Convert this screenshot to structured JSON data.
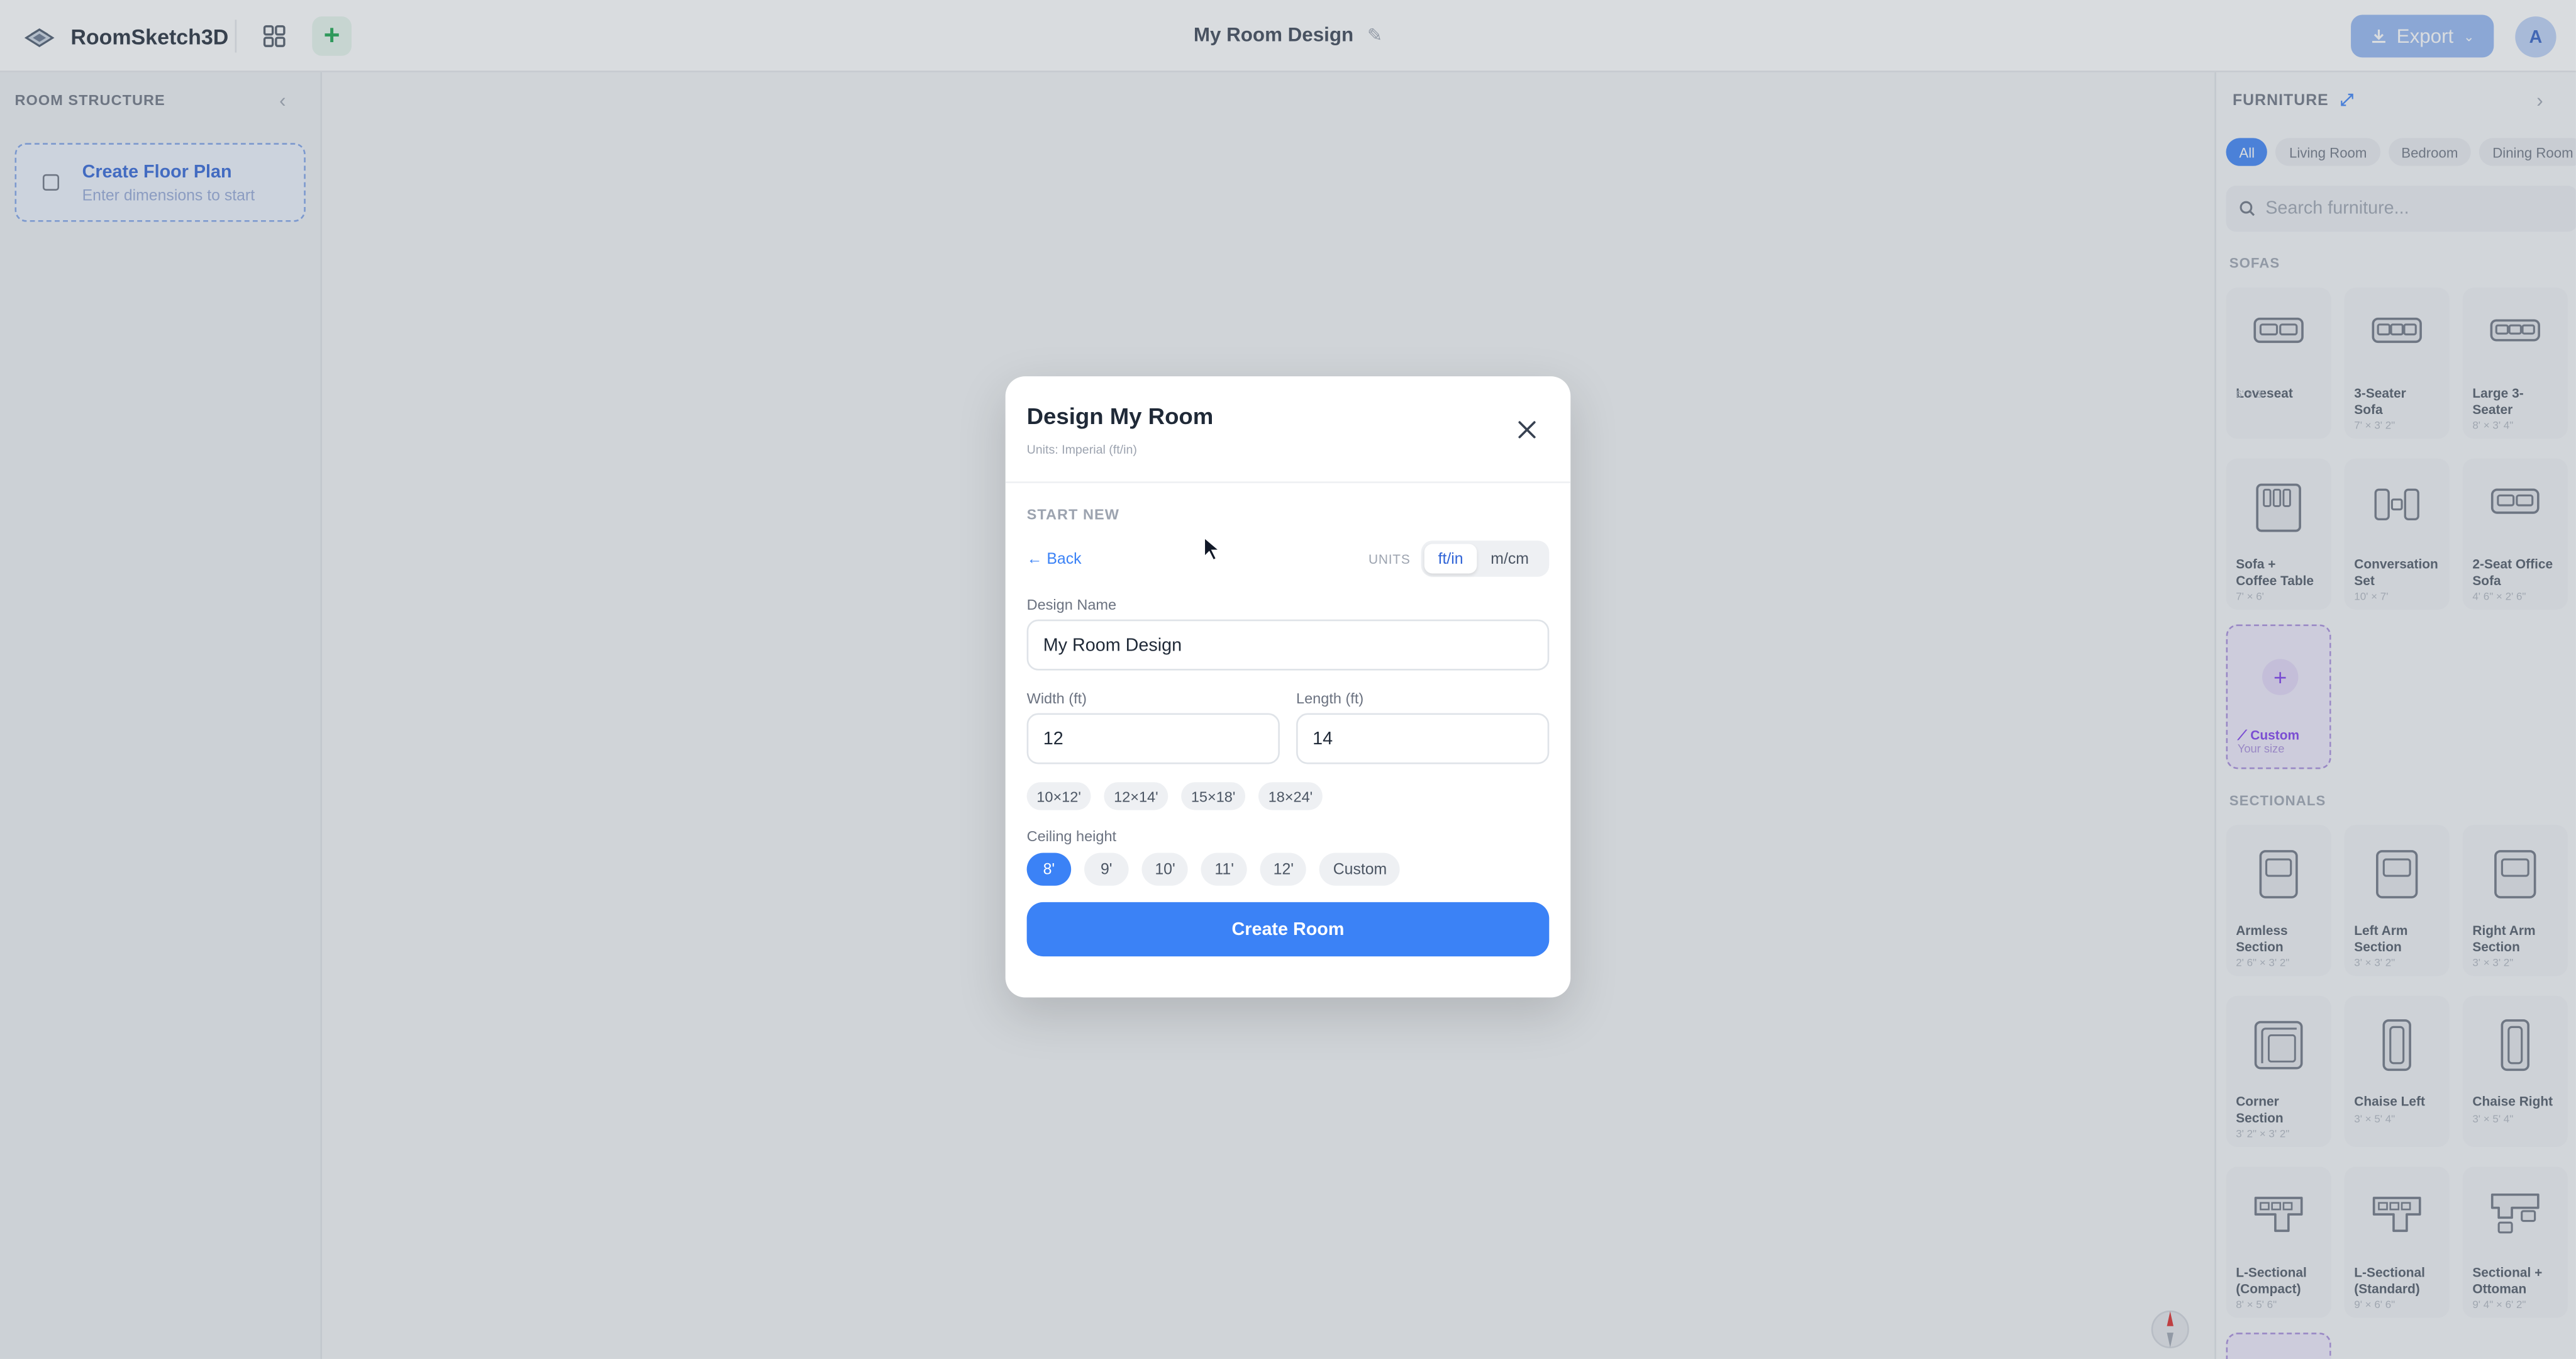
{
  "header": {
    "app_name": "RoomSketch3D",
    "design_title": "My Room Design",
    "export_label": "Export",
    "avatar_initial": "A"
  },
  "left_panel": {
    "title": "ROOM STRUCTURE",
    "floor_plan": {
      "title": "Create Floor Plan",
      "subtitle": "Enter dimensions to start"
    }
  },
  "right_panel": {
    "title": "FURNITURE",
    "tabs": [
      "All",
      "Living Room",
      "Bedroom",
      "Dining Room"
    ],
    "search_placeholder": "Search furniture...",
    "sections": {
      "sofas": "SOFAS",
      "sectionals": "SECTIONALS"
    },
    "sofas": [
      {
        "name": "Loveseat",
        "name2": "",
        "dim": "6' × 3'"
      },
      {
        "name": "3-Seater",
        "name2": "Sofa",
        "dim": "7' × 3' 2\""
      },
      {
        "name": "Large 3-",
        "name2": "Seater",
        "dim": "8' × 3' 4\""
      },
      {
        "name": "Sofa +",
        "name2": "Coffee Table",
        "dim": "7' × 6'"
      },
      {
        "name": "Conversation",
        "name2": "Set",
        "dim": "10' × 7'"
      },
      {
        "name": "2-Seat Office",
        "name2": "Sofa",
        "dim": "4' 6\" × 2' 6\""
      }
    ],
    "custom": {
      "label": "Custom",
      "sub": "Your size"
    },
    "sectionals": [
      {
        "name": "Armless",
        "name2": "Section",
        "dim": "2' 6\" × 3' 2\""
      },
      {
        "name": "Left Arm",
        "name2": "Section",
        "dim": "3' × 3' 2\""
      },
      {
        "name": "Right Arm",
        "name2": "Section",
        "dim": "3' × 3' 2\""
      },
      {
        "name": "Corner",
        "name2": "Section",
        "dim": "3' 2\" × 3' 2\""
      },
      {
        "name": "Chaise Left",
        "name2": "",
        "dim": "3' × 5' 4\""
      },
      {
        "name": "Chaise Right",
        "name2": "",
        "dim": "3' × 5' 4\""
      },
      {
        "name": "L-Sectional",
        "name2": "(Compact)",
        "dim": "8' × 5' 6\""
      },
      {
        "name": "L-Sectional",
        "name2": "(Standard)",
        "dim": "9' × 6' 6\""
      },
      {
        "name": "Sectional +",
        "name2": "Ottoman",
        "dim": "9' 4\" × 6' 2\""
      }
    ]
  },
  "modal": {
    "title": "Design My Room",
    "subtitle": "Units: Imperial (ft/in)",
    "section": "START NEW",
    "back": "← Back",
    "units_label": "UNITS",
    "unit_options": [
      "ft/in",
      "m/cm"
    ],
    "selected_unit": "ft/in",
    "design_name_label": "Design Name",
    "design_name_value": "My Room Design",
    "width_label": "Width (ft)",
    "width_value": "12",
    "length_label": "Length (ft)",
    "length_value": "14",
    "presets": [
      "10×12'",
      "12×14'",
      "15×18'",
      "18×24'"
    ],
    "ceiling_label": "Ceiling height",
    "ceiling_options": [
      "8'",
      "9'",
      "10'",
      "11'",
      "12'",
      "Custom"
    ],
    "selected_ceiling": "8'",
    "create_label": "Create Room"
  },
  "colors": {
    "accent": "#3b82f6",
    "custom_purple": "#7c3aed",
    "add_green": "#16a34a"
  }
}
